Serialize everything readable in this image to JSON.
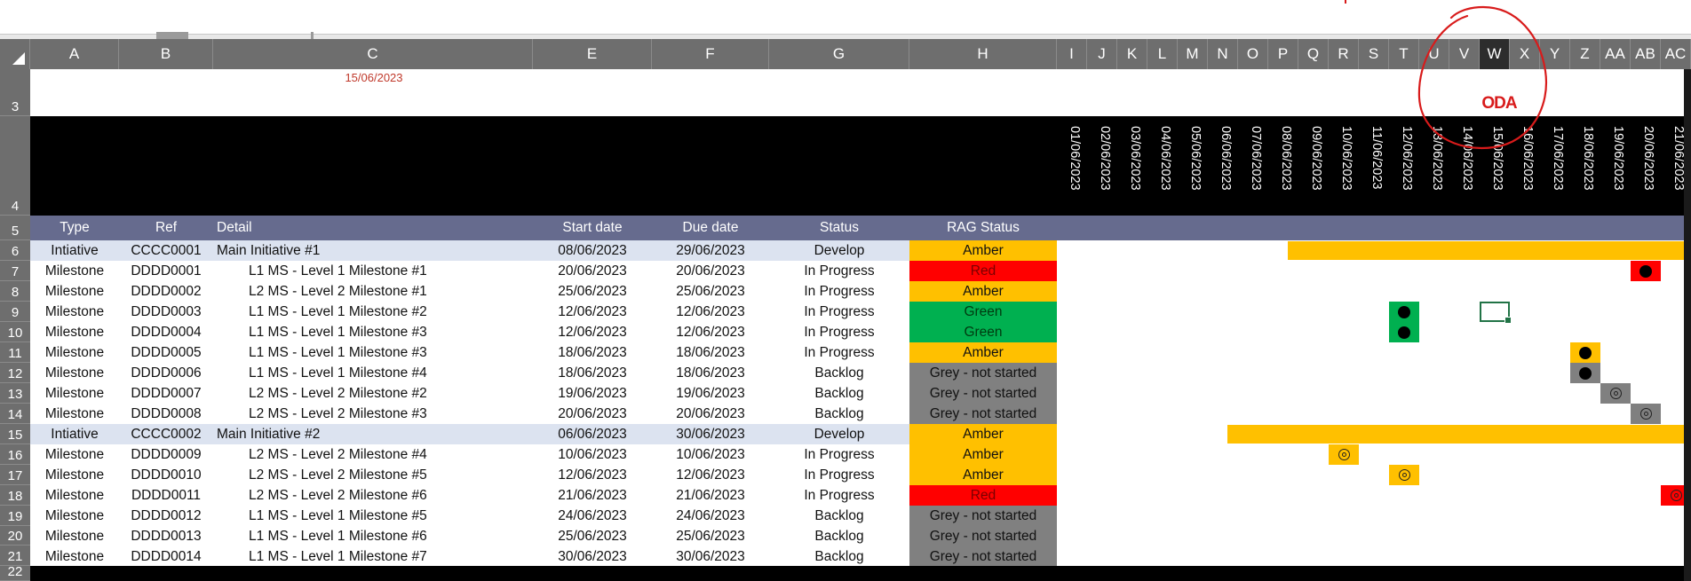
{
  "header_cell_date": "15/06/2023",
  "today_label": "ODA",
  "columns": [
    {
      "name": "col-a",
      "label": "A"
    },
    {
      "name": "col-b",
      "label": "B"
    },
    {
      "name": "col-c",
      "label": "C"
    },
    {
      "name": "col-e",
      "label": "E"
    },
    {
      "name": "col-f",
      "label": "F"
    },
    {
      "name": "col-g",
      "label": "G"
    },
    {
      "name": "col-h",
      "label": "H"
    },
    {
      "name": "col-i",
      "label": "I"
    },
    {
      "name": "col-j",
      "label": "J"
    },
    {
      "name": "col-k",
      "label": "K"
    },
    {
      "name": "col-l",
      "label": "L"
    },
    {
      "name": "col-m",
      "label": "M"
    },
    {
      "name": "col-n",
      "label": "N"
    },
    {
      "name": "col-o",
      "label": "O"
    },
    {
      "name": "col-p",
      "label": "P"
    },
    {
      "name": "col-q",
      "label": "Q"
    },
    {
      "name": "col-r",
      "label": "R"
    },
    {
      "name": "col-s",
      "label": "S"
    },
    {
      "name": "col-t",
      "label": "T"
    },
    {
      "name": "col-u",
      "label": "U"
    },
    {
      "name": "col-v",
      "label": "V"
    },
    {
      "name": "col-w",
      "label": "W"
    },
    {
      "name": "col-x",
      "label": "X"
    },
    {
      "name": "col-y",
      "label": "Y"
    },
    {
      "name": "col-z",
      "label": "Z"
    },
    {
      "name": "col-aa",
      "label": "AA"
    },
    {
      "name": "col-ab",
      "label": "AB"
    },
    {
      "name": "col-ac",
      "label": "AC"
    }
  ],
  "selected_column": "W",
  "row_numbers": [
    "3",
    "4",
    "5",
    "6",
    "7",
    "8",
    "9",
    "10",
    "11",
    "12",
    "13",
    "14",
    "15",
    "16",
    "17",
    "18",
    "19",
    "20",
    "21",
    "22"
  ],
  "table_headers": {
    "type": "Type",
    "ref": "Ref",
    "detail": "Detail",
    "start": "Start date",
    "due": "Due date",
    "status": "Status",
    "rag": "RAG Status"
  },
  "timeline_dates": [
    "01/06/2023",
    "02/06/2023",
    "03/06/2023",
    "04/06/2023",
    "05/06/2023",
    "06/06/2023",
    "07/06/2023",
    "08/06/2023",
    "09/06/2023",
    "10/06/2023",
    "11/06/2023",
    "12/06/2023",
    "13/06/2023",
    "14/06/2023",
    "15/06/2023",
    "16/06/2023",
    "17/06/2023",
    "18/06/2023",
    "19/06/2023",
    "20/06/2023",
    "21/06/2023"
  ],
  "rows": [
    {
      "type": "Intiative",
      "ref": "CCCC0001",
      "detail": "Main Initiative #1",
      "start": "08/06/2023",
      "due": "29/06/2023",
      "status": "Develop",
      "rag": "Amber",
      "initiative": true
    },
    {
      "type": "Milestone",
      "ref": "DDDD0001",
      "detail": "L1 MS - Level 1 Milestone #1",
      "start": "20/06/2023",
      "due": "20/06/2023",
      "status": "In Progress",
      "rag": "Red",
      "initiative": false
    },
    {
      "type": "Milestone",
      "ref": "DDDD0002",
      "detail": "L2 MS - Level 2 Milestone #1",
      "start": "25/06/2023",
      "due": "25/06/2023",
      "status": "In Progress",
      "rag": "Amber",
      "initiative": false
    },
    {
      "type": "Milestone",
      "ref": "DDDD0003",
      "detail": "L1 MS - Level 1 Milestone #2",
      "start": "12/06/2023",
      "due": "12/06/2023",
      "status": "In Progress",
      "rag": "Green",
      "initiative": false
    },
    {
      "type": "Milestone",
      "ref": "DDDD0004",
      "detail": "L1 MS - Level 1 Milestone #3",
      "start": "12/06/2023",
      "due": "12/06/2023",
      "status": "In Progress",
      "rag": "Green",
      "initiative": false
    },
    {
      "type": "Milestone",
      "ref": "DDDD0005",
      "detail": "L1 MS - Level 1 Milestone #3",
      "start": "18/06/2023",
      "due": "18/06/2023",
      "status": "In Progress",
      "rag": "Amber",
      "initiative": false
    },
    {
      "type": "Milestone",
      "ref": "DDDD0006",
      "detail": "L1 MS - Level 1 Milestone #4",
      "start": "18/06/2023",
      "due": "18/06/2023",
      "status": "Backlog",
      "rag": "Grey - not started",
      "initiative": false
    },
    {
      "type": "Milestone",
      "ref": "DDDD0007",
      "detail": "L2 MS - Level 2 Milestone #2",
      "start": "19/06/2023",
      "due": "19/06/2023",
      "status": "Backlog",
      "rag": "Grey - not started",
      "initiative": false
    },
    {
      "type": "Milestone",
      "ref": "DDDD0008",
      "detail": "L2 MS - Level 2 Milestone #3",
      "start": "20/06/2023",
      "due": "20/06/2023",
      "status": "Backlog",
      "rag": "Grey - not started",
      "initiative": false
    },
    {
      "type": "Intiative",
      "ref": "CCCC0002",
      "detail": "Main Initiative #2",
      "start": "06/06/2023",
      "due": "30/06/2023",
      "status": "Develop",
      "rag": "Amber",
      "initiative": true
    },
    {
      "type": "Milestone",
      "ref": "DDDD0009",
      "detail": "L2 MS - Level 2 Milestone #4",
      "start": "10/06/2023",
      "due": "10/06/2023",
      "status": "In Progress",
      "rag": "Amber",
      "initiative": false
    },
    {
      "type": "Milestone",
      "ref": "DDDD0010",
      "detail": "L2 MS - Level 2 Milestone #5",
      "start": "12/06/2023",
      "due": "12/06/2023",
      "status": "In Progress",
      "rag": "Amber",
      "initiative": false
    },
    {
      "type": "Milestone",
      "ref": "DDDD0011",
      "detail": "L2 MS - Level 2 Milestone #6",
      "start": "21/06/2023",
      "due": "21/06/2023",
      "status": "In Progress",
      "rag": "Red",
      "initiative": false
    },
    {
      "type": "Milestone",
      "ref": "DDDD0012",
      "detail": "L1 MS - Level 1 Milestone #5",
      "start": "24/06/2023",
      "due": "24/06/2023",
      "status": "Backlog",
      "rag": "Grey - not started",
      "initiative": false
    },
    {
      "type": "Milestone",
      "ref": "DDDD0013",
      "detail": "L1 MS - Level 1 Milestone #6",
      "start": "25/06/2023",
      "due": "25/06/2023",
      "status": "Backlog",
      "rag": "Grey - not started",
      "initiative": false
    },
    {
      "type": "Milestone",
      "ref": "DDDD0014",
      "detail": "L1 MS - Level 1 Milestone #7",
      "start": "30/06/2023",
      "due": "30/06/2023",
      "status": "Backlog",
      "rag": "Grey - not started",
      "initiative": false
    }
  ],
  "rag_colors": {
    "Amber": "#ffc000",
    "Red": "#ff0000",
    "Green": "#00b050",
    "Grey - not started": "#808080"
  },
  "rag_text_colors": {
    "Amber": "#111111",
    "Red": "#7a0000",
    "Green": "#003a10",
    "Grey - not started": "#111111"
  },
  "gantt_marks": [
    {
      "row": 0,
      "kind": "bar",
      "from": "08/06/2023",
      "to": "21/06/2023",
      "rag": "Amber"
    },
    {
      "row": 1,
      "kind": "dot",
      "day": "20/06/2023",
      "rag": "Red"
    },
    {
      "row": 3,
      "kind": "dot",
      "day": "12/06/2023",
      "rag": "Green"
    },
    {
      "row": 4,
      "kind": "dot",
      "day": "12/06/2023",
      "rag": "Green"
    },
    {
      "row": 5,
      "kind": "dot",
      "day": "18/06/2023",
      "rag": "Amber"
    },
    {
      "row": 6,
      "kind": "dot",
      "day": "18/06/2023",
      "rag": "Grey - not started"
    },
    {
      "row": 7,
      "kind": "ring",
      "day": "19/06/2023",
      "rag": "Grey - not started"
    },
    {
      "row": 8,
      "kind": "ring",
      "day": "20/06/2023",
      "rag": "Grey - not started"
    },
    {
      "row": 9,
      "kind": "bar",
      "from": "06/06/2023",
      "to": "21/06/2023",
      "rag": "Amber"
    },
    {
      "row": 10,
      "kind": "ring",
      "day": "10/06/2023",
      "rag": "Amber"
    },
    {
      "row": 11,
      "kind": "ring",
      "day": "12/06/2023",
      "rag": "Amber"
    },
    {
      "row": 12,
      "kind": "ring",
      "day": "21/06/2023",
      "rag": "Red"
    }
  ],
  "selected_cell": {
    "row": 3,
    "day": "15/06/2023"
  },
  "colors": {
    "header_row": "#666b8e",
    "initiative_row": "#dce3f0",
    "date_header_bg": "#000000",
    "annotation": "#d81b1b",
    "selection": "#217346"
  }
}
